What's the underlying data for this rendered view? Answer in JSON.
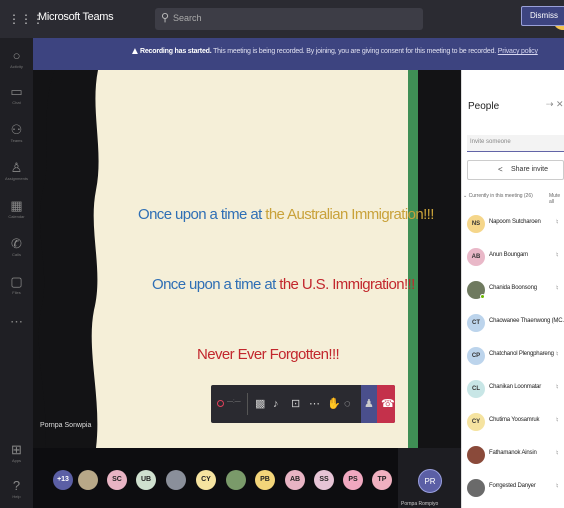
{
  "app": {
    "title": "Microsoft Teams"
  },
  "search": {
    "placeholder": "Search"
  },
  "top_avatar": {
    "initial": "N"
  },
  "rail": [
    {
      "icon": "○",
      "label": "Activity"
    },
    {
      "icon": "▭",
      "label": "Chat"
    },
    {
      "icon": "⚇",
      "label": "Teams"
    },
    {
      "icon": "♙",
      "label": "Assignments"
    },
    {
      "icon": "▦",
      "label": "Calendar"
    },
    {
      "icon": "✆",
      "label": "Calls"
    },
    {
      "icon": "▢",
      "label": "Files"
    },
    {
      "icon": "⋯",
      "label": ""
    },
    {
      "icon": "⊞",
      "label": "Apps"
    },
    {
      "icon": "?",
      "label": "Help"
    }
  ],
  "banner": {
    "bold": "Recording has started.",
    "text": "This meeting is being recorded. By joining, you are giving consent for this meeting to be recorded.",
    "link": "Privacy policy",
    "dismiss": "Dismiss"
  },
  "slide": {
    "line1_a": "Once upon a time at ",
    "line1_b": "the Australian Immigration!!!",
    "line2_a": "Once upon a time at ",
    "line2_b": "the U.S. Immigration!!!",
    "line3": "Never Ever Forgotten!!!"
  },
  "presenter": {
    "name": "Pornpa Sonwpia"
  },
  "controls": {
    "time": "—:—"
  },
  "strip": {
    "avatars": [
      {
        "label": "+13",
        "color": "#5b5fa5",
        "text_color": "#ffffff"
      },
      {
        "label": "",
        "color": "#b8a888",
        "text_color": "#222222"
      },
      {
        "label": "SC",
        "color": "#e8b4c4",
        "text_color": "#222222"
      },
      {
        "label": "UB",
        "color": "#cfe0cf",
        "text_color": "#222222"
      },
      {
        "label": "",
        "color": "#8a8f9a",
        "text_color": "#222222"
      },
      {
        "label": "CY",
        "color": "#f5e3a0",
        "text_color": "#222222"
      },
      {
        "label": "",
        "color": "#7a9a6a",
        "text_color": "#222222"
      },
      {
        "label": "PB",
        "color": "#f3d57a",
        "text_color": "#222222"
      },
      {
        "label": "AB",
        "color": "#e8b4c4",
        "text_color": "#222222"
      },
      {
        "label": "SS",
        "color": "#e6c4d6",
        "text_color": "#222222"
      },
      {
        "label": "PS",
        "color": "#f0a8c0",
        "text_color": "#222222"
      },
      {
        "label": "TP",
        "color": "#f0b0c0",
        "text_color": "#222222"
      }
    ],
    "pr_initials": "PR",
    "pr_name": "Pornpa Rompiyo"
  },
  "panel": {
    "title": "People",
    "invite_placeholder": "Invite someone",
    "share_invite": "Share invite",
    "section": "Currently in this meeting (26)",
    "mute_all": "Mute all",
    "people": [
      {
        "initials": "NS",
        "name": "Napoom Sutcharoen",
        "color": "#f5d68a"
      },
      {
        "initials": "AB",
        "name": "Anun Boungam",
        "color": "#e9b8c8"
      },
      {
        "initials": "",
        "name": "Chanida Boonsong",
        "color": "#6f7a5f",
        "online": true
      },
      {
        "initials": "CT",
        "name": "Chaowanee Thaenwong (MC...",
        "color": "#bcd4ec"
      },
      {
        "initials": "CP",
        "name": "Chatchanol Plengphareng",
        "color": "#bcd4ec"
      },
      {
        "initials": "CL",
        "name": "Chanikan Loonmatar",
        "color": "#c8e6e6"
      },
      {
        "initials": "CY",
        "name": "Chutima Yoosamruk",
        "color": "#f5e3a0"
      },
      {
        "initials": "",
        "name": "Fathamanok Ainsin",
        "color": "#8a4a3a"
      },
      {
        "initials": "",
        "name": "Forrgested Danyer",
        "color": "#6a6a6a"
      }
    ]
  }
}
